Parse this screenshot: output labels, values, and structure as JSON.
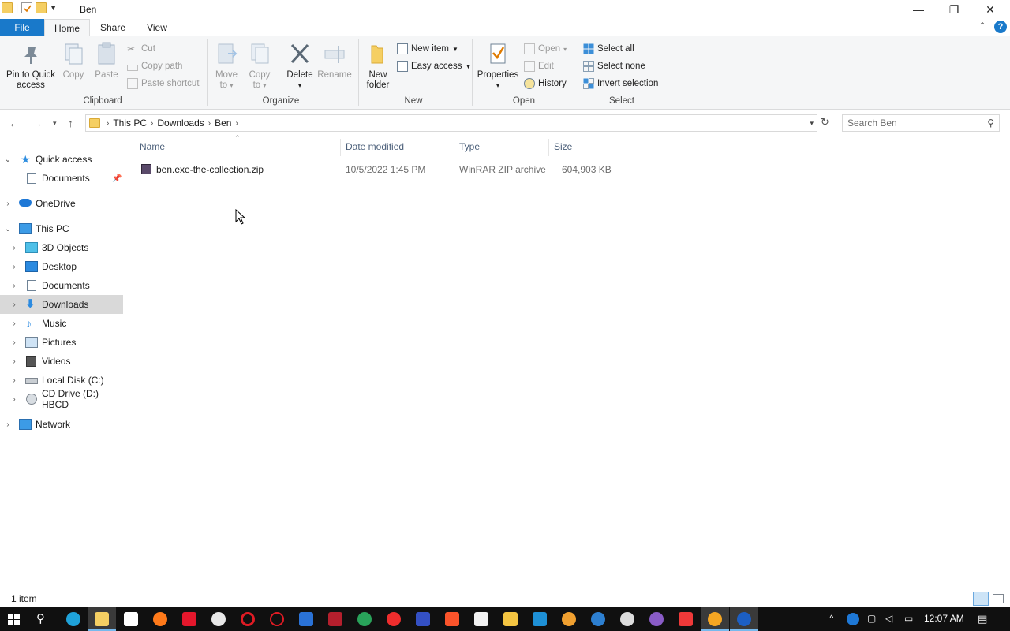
{
  "window": {
    "title": "Ben",
    "controls": {
      "minimize": "—",
      "restore": "❐",
      "close": "✕"
    }
  },
  "ribbon_tabs": [
    "File",
    "Home",
    "Share",
    "View"
  ],
  "ribbon": {
    "clipboard": {
      "label": "Clipboard",
      "pin": "Pin to Quick\naccess",
      "copy": "Copy",
      "paste": "Paste",
      "cut": "Cut",
      "copy_path": "Copy path",
      "paste_shortcut": "Paste shortcut"
    },
    "organize": {
      "label": "Organize",
      "move_to": "Move\nto",
      "copy_to": "Copy\nto",
      "delete": "Delete",
      "rename": "Rename"
    },
    "new": {
      "label": "New",
      "new_folder": "New\nfolder",
      "new_item": "New item",
      "easy_access": "Easy access"
    },
    "open": {
      "label": "Open",
      "properties": "Properties",
      "open": "Open",
      "edit": "Edit",
      "history": "History"
    },
    "select": {
      "label": "Select",
      "select_all": "Select all",
      "select_none": "Select none",
      "invert": "Invert selection"
    }
  },
  "address": {
    "crumbs": [
      "This PC",
      "Downloads",
      "Ben"
    ],
    "search_placeholder": "Search Ben"
  },
  "nav_pane": {
    "quick_access": "Quick access",
    "qa_documents": "Documents",
    "onedrive": "OneDrive",
    "this_pc": "This PC",
    "items": [
      "3D Objects",
      "Desktop",
      "Documents",
      "Downloads",
      "Music",
      "Pictures",
      "Videos",
      "Local Disk (C:)",
      "CD Drive (D:) HBCD"
    ],
    "network": "Network"
  },
  "columns": {
    "name": "Name",
    "date": "Date modified",
    "type": "Type",
    "size": "Size"
  },
  "files": [
    {
      "name": "ben.exe-the-collection.zip",
      "date": "10/5/2022 1:45 PM",
      "type": "WinRAR ZIP archive",
      "size": "604,903 KB"
    }
  ],
  "status": {
    "count": "1 item"
  },
  "taskbar": {
    "time": "12:07 AM"
  },
  "colors": {
    "accent": "#1979ca",
    "selected_nav": "#d9d9d9",
    "folder": "#f5cf63"
  }
}
